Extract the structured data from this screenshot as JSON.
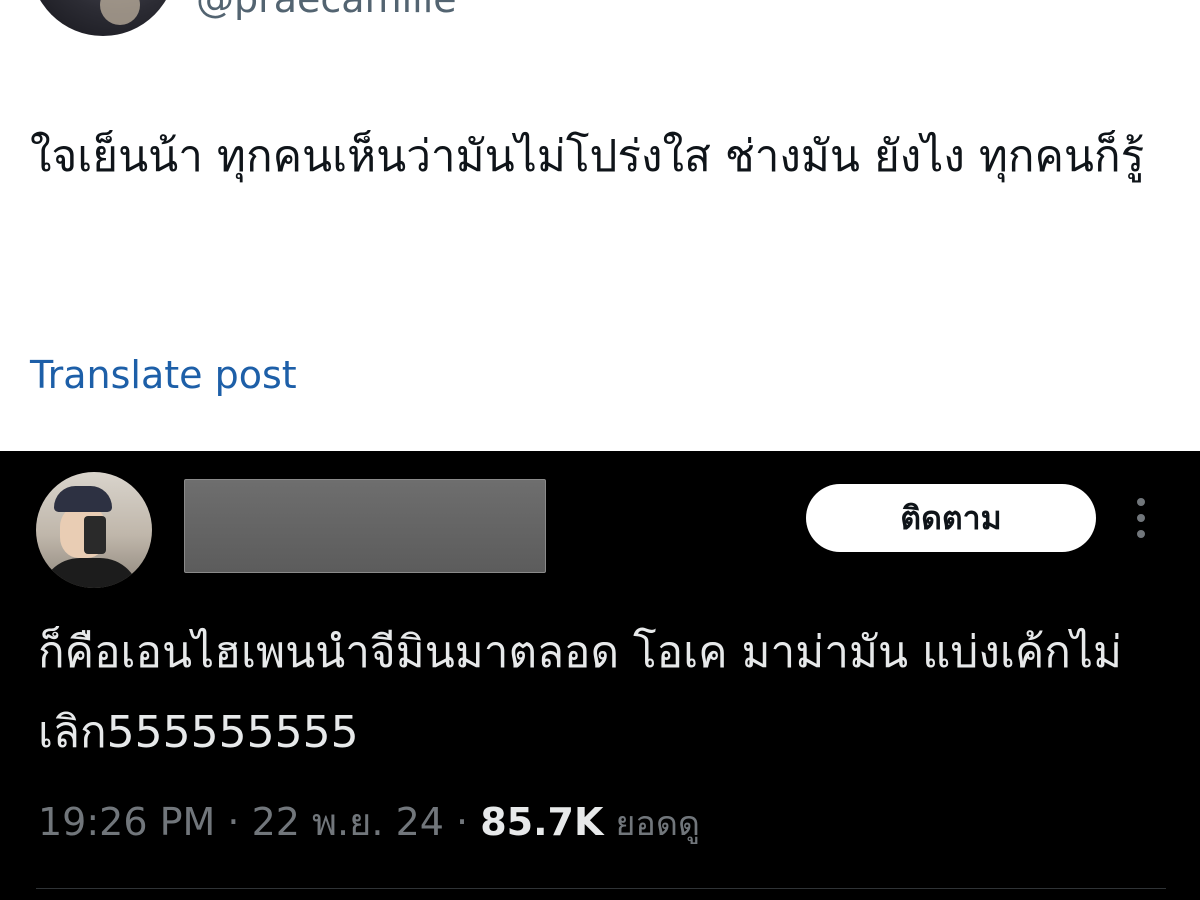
{
  "light_post": {
    "handle": "@praecamille",
    "text": "ใจเย็นน้า ทุกคนเห็นว่ามันไม่โปร่งใส ช่างมัน ยังไง ทุกคนก็รู้",
    "translate_label": "Translate post"
  },
  "dark_post": {
    "follow_label": "ติดตาม",
    "text": "ก็คือเอนไฮเพนนำจีมินมาตลอด โอเค มาม่ามัน แบ่งเค้กไม่เลิก555555555",
    "time": "19:26 PM",
    "separator": "·",
    "date": "22 พ.ย. 24",
    "views_count": "85.7K",
    "views_label": "ยอดดู"
  },
  "colors": {
    "light_bg": "#ffffff",
    "dark_bg": "#000000",
    "link_blue": "#1d5fa8",
    "muted_gray": "#71767b"
  },
  "icons": {
    "more": "more-vertical-icon"
  }
}
